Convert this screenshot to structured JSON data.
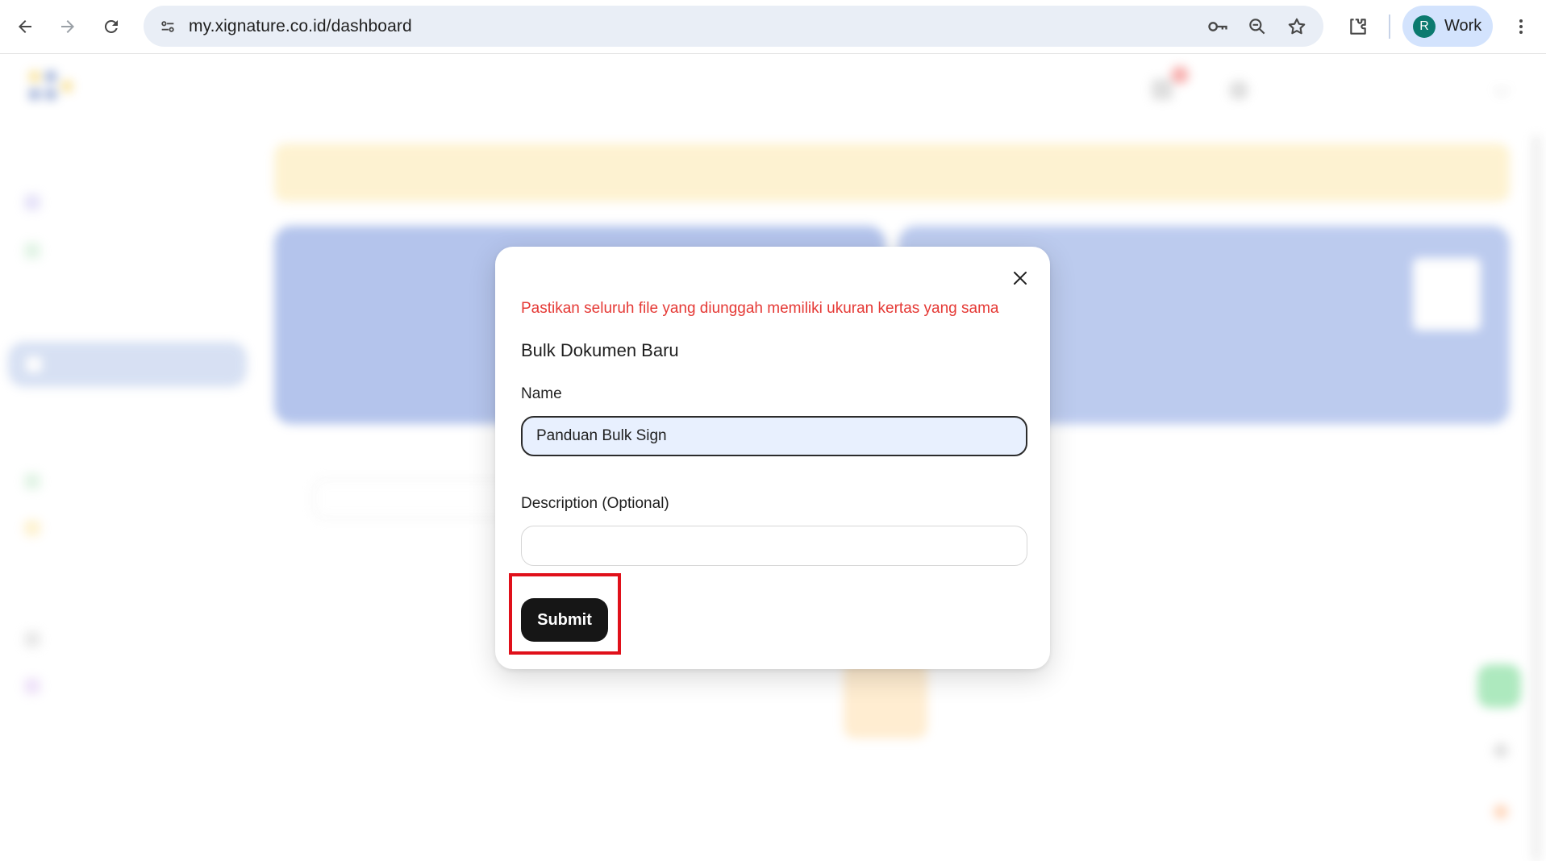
{
  "browser": {
    "url": "my.xignature.co.id/dashboard",
    "profile": {
      "initial": "R",
      "label": "Work",
      "avatar_color": "#0b7a6f"
    },
    "icons": [
      "back-arrow-icon",
      "forward-arrow-icon",
      "reload-icon",
      "site-info-icon",
      "password-key-icon",
      "zoom-icon",
      "bookmark-star-icon",
      "extensions-puzzle-icon",
      "kebab-menu-icon"
    ]
  },
  "modal": {
    "warning": "Pastikan seluruh file yang diunggah memiliki ukuran kertas yang sama",
    "title": "Bulk Dokumen Baru",
    "name_label": "Name",
    "name_value": "Panduan Bulk Sign",
    "description_label": "Description (Optional)",
    "description_value": "",
    "submit_label": "Submit",
    "warning_color": "#e53935",
    "highlight_color": "#e0101a"
  }
}
